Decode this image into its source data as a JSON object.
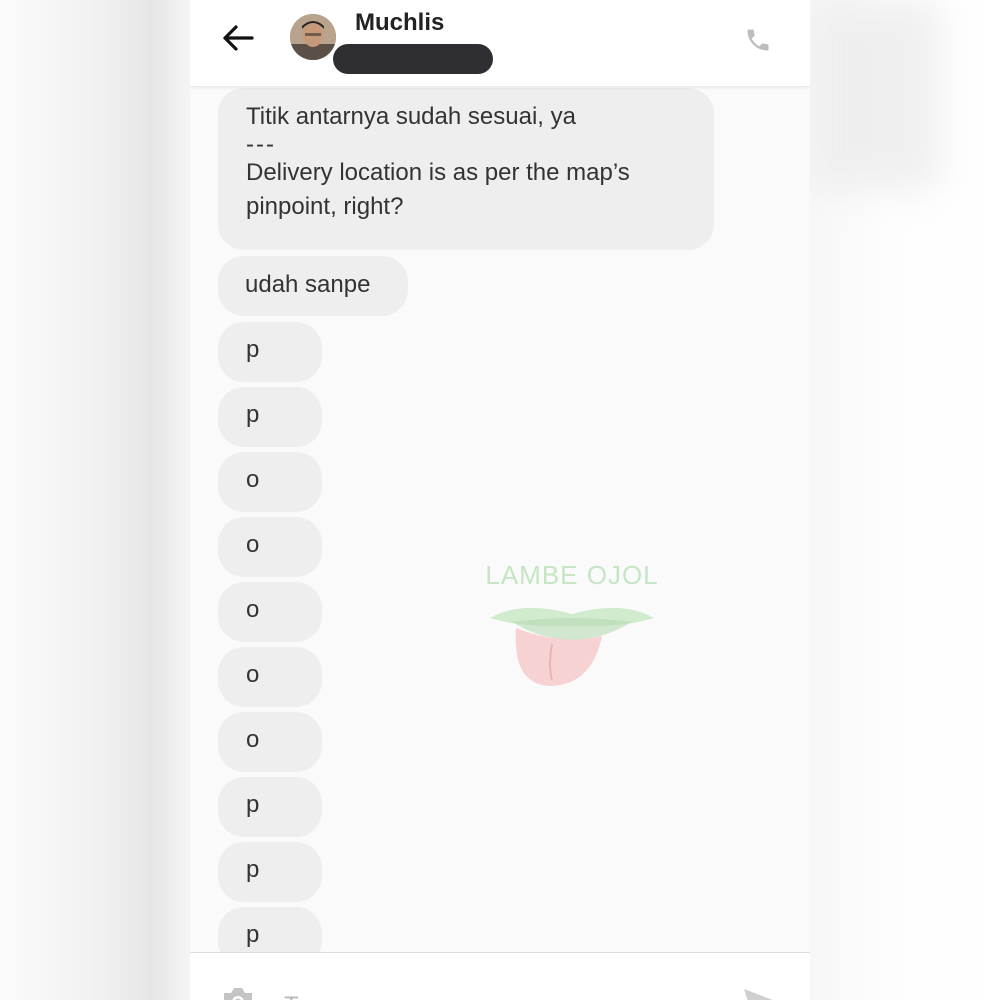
{
  "contact": {
    "name": "Muchlis"
  },
  "messages": [
    {
      "lines": [
        "Titik antarnya sudah sesuai, ya",
        "---",
        "Delivery location is as per the map’s",
        "pinpoint, right?"
      ]
    },
    {
      "text": "udah sanpe"
    },
    {
      "text": "p"
    },
    {
      "text": "p"
    },
    {
      "text": "o"
    },
    {
      "text": "o"
    },
    {
      "text": "o"
    },
    {
      "text": "o"
    },
    {
      "text": "o"
    },
    {
      "text": "p"
    },
    {
      "text": "p"
    },
    {
      "text": "p"
    }
  ],
  "watermark": {
    "text": "LAMBE OJOL"
  },
  "composer": {
    "placeholder": "Type a message"
  },
  "icons": {
    "back": "arrow-left-icon",
    "call": "phone-icon",
    "camera": "camera-icon",
    "send": "send-icon"
  },
  "colors": {
    "bubble": "#eeeeee",
    "background": "#fafafa",
    "redaction": "#2e2e33",
    "watermark_text": "#8fd08a",
    "watermark_tongue": "#e87d7d"
  }
}
